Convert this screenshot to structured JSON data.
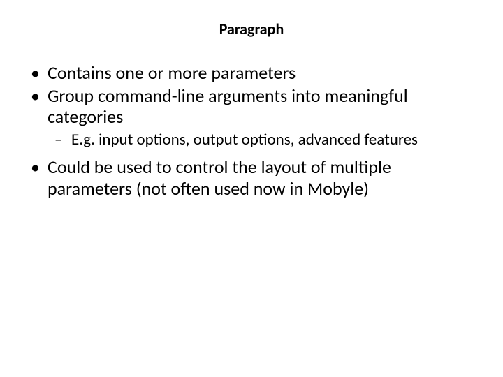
{
  "title": "Paragraph",
  "bullets": {
    "b1": "Contains one or more parameters",
    "b2": "Group command-line arguments into meaningful categories",
    "b2_sub1": "E.g. input options, output options, advanced features",
    "b3": "Could be used to control the layout of multiple parameters (not often used now in Mobyle)"
  }
}
